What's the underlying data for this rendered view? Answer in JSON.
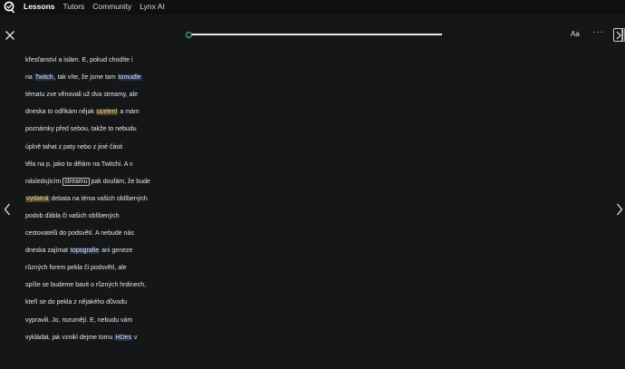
{
  "topnav": {
    "items": [
      {
        "label": "Lessons",
        "active": true
      },
      {
        "label": "Tutors",
        "active": false
      },
      {
        "label": "Community",
        "active": false
      },
      {
        "label": "Lynx AI",
        "active": false
      }
    ]
  },
  "toolbar": {
    "font_label": "Aa",
    "more_label": "···",
    "progress": 0.0
  },
  "colors": {
    "background": "#151618",
    "topbar": "#0f1012",
    "text": "#e6e6e6",
    "highlight_blue": "#263042",
    "highlight_yellow": "#4a3f25",
    "progress_accent": "#4ac08a"
  },
  "icons": [
    "lingq-logo-icon",
    "close-icon",
    "chevron-left-icon",
    "chevron-right-icon",
    "sidebar-panel-icon"
  ],
  "reader": {
    "lines": [
      [
        {
          "t": "křesťanství a islám. E, pokud chodíte i"
        }
      ],
      [
        {
          "t": "na "
        },
        {
          "t": "Twitch",
          "h": "blue"
        },
        {
          "t": ", tak víte, že jsme tam "
        },
        {
          "t": "tomudle",
          "h": "blue"
        }
      ],
      [
        {
          "t": "tématu zve věnovali už dva streamy, ale"
        }
      ],
      [
        {
          "t": "dneska to odřikám nějak "
        },
        {
          "t": "ucelení",
          "h": "yellow"
        },
        {
          "t": " a mám"
        }
      ],
      [
        {
          "t": "poznámky před sebou, takže to nebudu"
        }
      ],
      [
        {
          "t": "úplně tahat z paty nebo z jiné části"
        }
      ],
      [
        {
          "t": "těla na p, jako to dělám na Twitchi. A v"
        }
      ],
      [
        {
          "t": "následujícím "
        },
        {
          "t": "streamu",
          "h": "box"
        },
        {
          "t": " pak doufám, že bude"
        }
      ],
      [
        {
          "t": "vydatná",
          "h": "yellow"
        },
        {
          "t": " debata na téma vašich oblíbených"
        }
      ],
      [
        {
          "t": "podob ďábla či vašich oblíbených"
        }
      ],
      [
        {
          "t": "cestovatelů do podsvětí. A nebude nás"
        }
      ],
      [
        {
          "t": "dneska zajímat "
        },
        {
          "t": "topografie",
          "h": "blue"
        },
        {
          "t": " ani geneze"
        }
      ],
      [
        {
          "t": "různých forem pekla či podsvětí, ale"
        }
      ],
      [
        {
          "t": "spíše se budeme bavit o různých hrdinech,"
        }
      ],
      [
        {
          "t": "kteří se do pekla z nějakého důvodu"
        }
      ],
      [
        {
          "t": "vypravili. Jo, rozumějí. E, nebudu vám"
        }
      ],
      [
        {
          "t": "vykládat, jak vznikl dejme tomu "
        },
        {
          "t": "HDes",
          "h": "blue"
        },
        {
          "t": " v"
        }
      ]
    ]
  }
}
